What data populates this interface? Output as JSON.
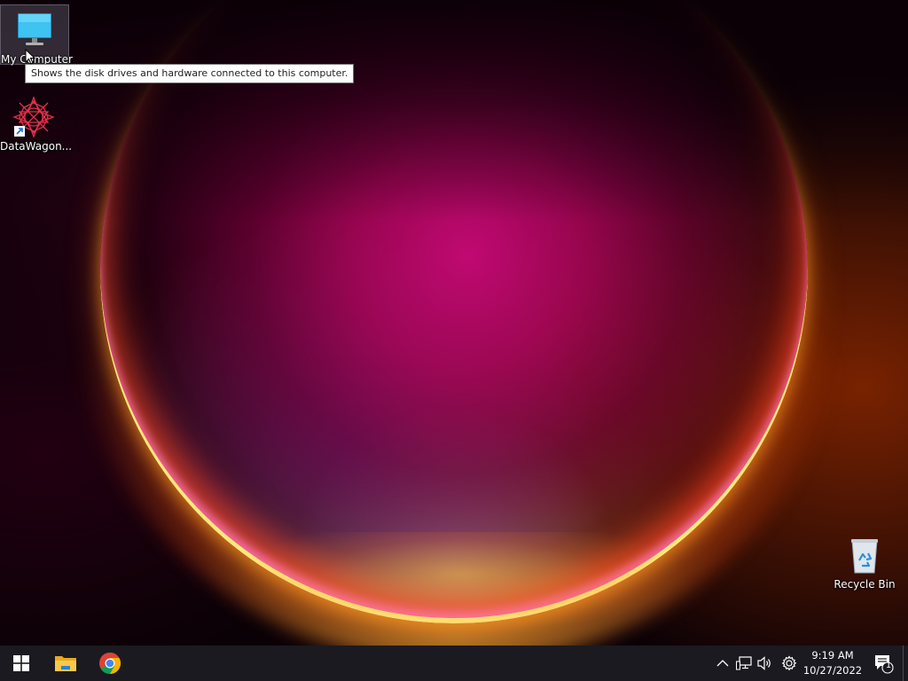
{
  "desktop": {
    "icons": [
      {
        "name": "my-computer",
        "label": "My Computer",
        "icon": "monitor-icon"
      },
      {
        "name": "datawagon",
        "label": "DataWagon...",
        "icon": "datawagon-shortcut-icon"
      },
      {
        "name": "recycle-bin",
        "label": "Recycle Bin",
        "icon": "recycle-bin-icon"
      }
    ],
    "tooltip": "Shows the disk drives and hardware connected to this computer."
  },
  "taskbar": {
    "start_icon": "windows-logo-icon",
    "pinned": [
      {
        "name": "file-explorer",
        "icon": "folder-icon"
      },
      {
        "name": "google-chrome",
        "icon": "chrome-icon"
      }
    ],
    "tray": {
      "icons": [
        "chevron-up-icon",
        "network-icon",
        "volume-icon",
        "settings-gear-icon"
      ],
      "time": "9:19 AM",
      "date": "10/27/2022",
      "notification_count": "1"
    }
  },
  "colors": {
    "taskbar": "#1b1a20",
    "accent_orb": "#c0107a",
    "explorer_folder": "#f2c230"
  }
}
